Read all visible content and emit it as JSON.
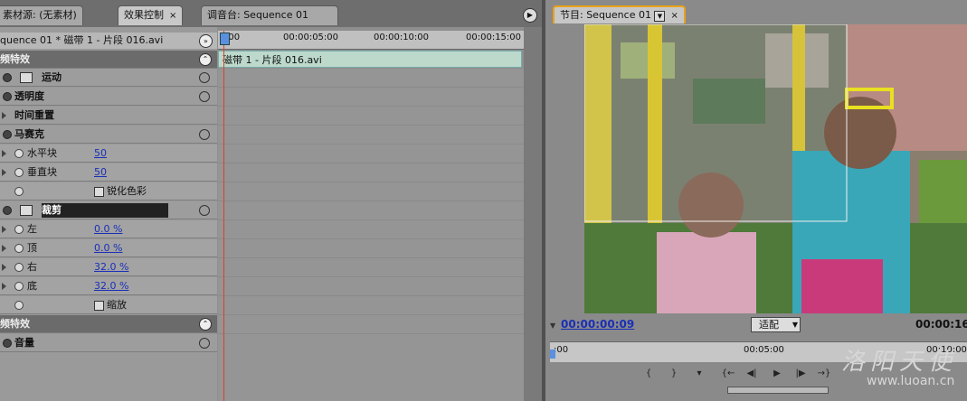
{
  "tabs": [
    {
      "label": "素材源: (无素材)"
    },
    {
      "label": "效果控制",
      "close": "×"
    },
    {
      "label": "调音台: Sequence 01"
    }
  ],
  "effect_controls": {
    "sequence_label": "quence 01 * 磁带 1 - 片段 016.avi",
    "video_effects_header": "频特效",
    "rows": {
      "motion": "运动",
      "opacity": "透明度",
      "time_remap": "时间重置",
      "mosaic": "马赛克",
      "h_blocks_label": "水平块",
      "h_blocks_value": "50",
      "v_blocks_label": "垂直块",
      "v_blocks_value": "50",
      "sharpen_label": "锐化色彩",
      "crop": "裁剪",
      "left_label": "左",
      "left_value": "0.0 %",
      "top_label": "顶",
      "top_value": "0.0 %",
      "right_label": "右",
      "right_value": "32.0 %",
      "bottom_label": "底",
      "bottom_value": "32.0 %",
      "zoom_label": "缩放"
    },
    "audio_effects_header": "频特效",
    "volume": "音量"
  },
  "timeline": {
    "ticks": [
      ":00",
      "00:00:05:00",
      "00:00:10:00",
      "00:00:15:00"
    ],
    "clip_label": "磁带 1 - 片段 016.avi"
  },
  "monitor": {
    "tab_label": "节目: Sequence 01",
    "tab_close": "×",
    "timecode_current": "00:00:00:09",
    "fit_label": "适配",
    "timecode_duration": "00:00:16",
    "ruler_ticks": [
      ":00",
      "00:05:00",
      "00:10:00"
    ],
    "watermark": "洛阳天使",
    "watermark_url": "www.luoan.cn"
  },
  "colors": {
    "accent_orange": "#e7a21a",
    "value_blue": "#1a2fb8",
    "playhead": "#e0402a",
    "clip": "#bcd9cc"
  }
}
